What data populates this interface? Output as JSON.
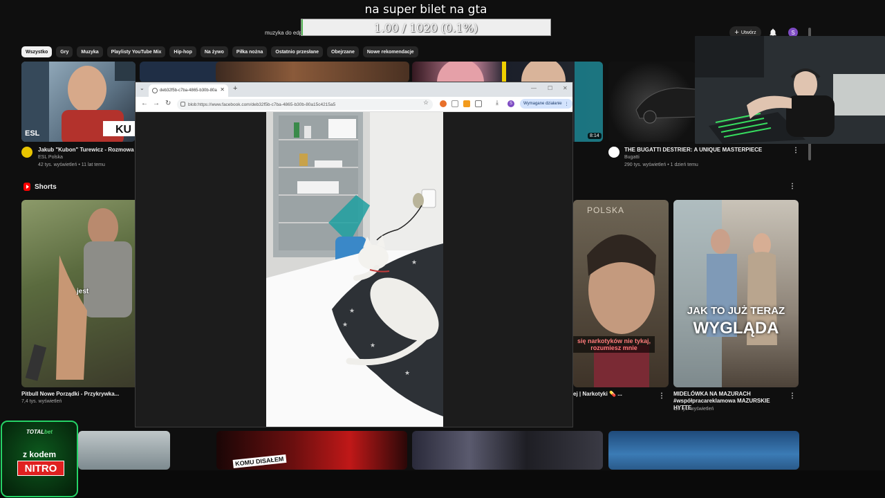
{
  "overlay": {
    "title": "na super bilet na gta",
    "progress_text": "1.00 / 1020 (0.1%)",
    "progress_fraction": 0.001
  },
  "youtube": {
    "search_value": "muzyka do edp",
    "create_label": "Utwórz",
    "avatar_letter": "S",
    "chips": [
      "Wszystko",
      "Gry",
      "Muzyka",
      "Playlisty YouTube Mix",
      "Hip-hop",
      "Na żywo",
      "Piłka nożna",
      "Ostatnio przesłane",
      "Obejrzane",
      "Nowe rekomendacje"
    ],
    "videos": [
      {
        "title": "Jakub \"Kubon\" Turewicz - Rozmowa z P",
        "channel": "ESL Polska",
        "meta": "42 tys. wyświetleń • 11 lat temu",
        "thumb_text": "ESL",
        "thumb_text2": "KU"
      },
      {
        "title": "THE BUGATTI DESTRIER: A UNIQUE MASTERPIECE",
        "channel": "Bugatti",
        "meta": "290 tys. wyświetleń • 1 dzień temu",
        "duration": "8:14"
      }
    ],
    "shorts_label": "Shorts",
    "shorts": [
      {
        "title": "Pitbull Nowe Porządki - Przykrywka...",
        "meta": "7,4 tys. wyświetleń",
        "caption": "jest",
        "badge": "🎬"
      },
      {
        "title": "ej | Narkotyki 💊 ...",
        "meta": "",
        "caption": "się narkotyków nie tykaj, rozumiesz mnie",
        "brand": "POLSKA"
      },
      {
        "title": "MIDELÓWKA NA MAZURACH #współpracareklamowa MAZURSKIE HYTTE",
        "meta": "1,6 tys. wyświetleń",
        "caption1": "JAK TO JUŻ TERAZ",
        "caption2": "WYGLĄDA"
      }
    ],
    "bottom_thumb_text": "KOMU DISAŁEM"
  },
  "chrome": {
    "tab_title": "deb32f5b-c7ba-4865-b30b-80a",
    "url": "blob:https://www.facebook.com/deb32f5b-c7ba-4865-b30b-80a15c4215a5",
    "required_action": "Wymagane działanie",
    "profile_letter": "S"
  },
  "promo": {
    "brand_a": "TOTAL",
    "brand_b": "bet",
    "line": "z kodem",
    "code": "NITRO"
  },
  "colors": {
    "yt_bg": "#0f0f0f",
    "chip_bg": "#272727",
    "progress_green": "#56b656",
    "promo_green": "#25d366",
    "promo_red": "#e02020"
  }
}
